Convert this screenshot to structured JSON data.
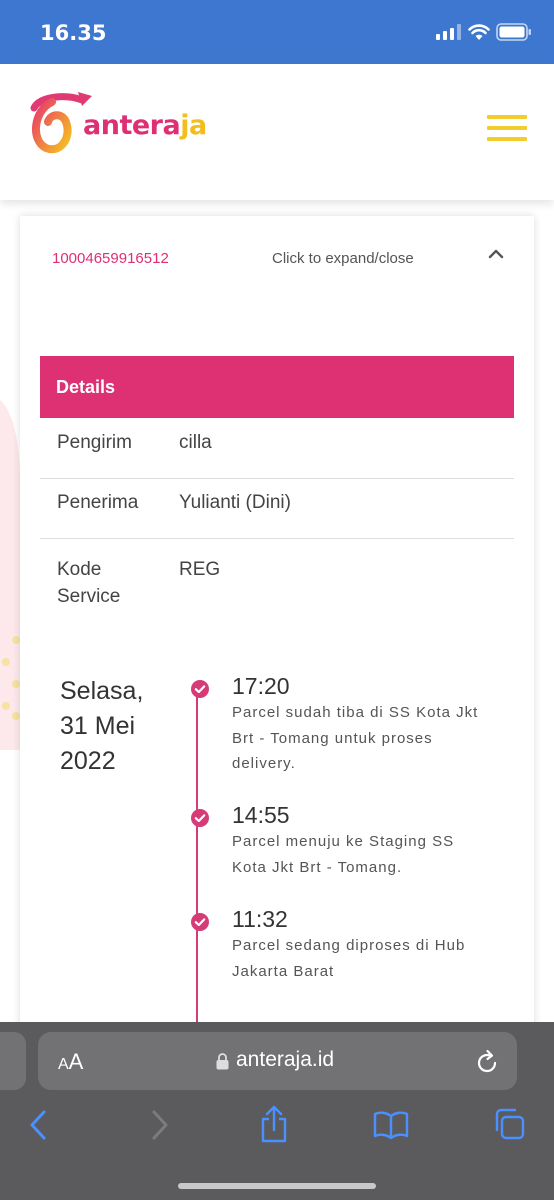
{
  "status_bar": {
    "time": "16.35"
  },
  "header": {
    "logo": {
      "part1": "antera",
      "part2": "ja"
    },
    "menu_icon": "hamburger-icon"
  },
  "tracking": {
    "awb_number": "10004659916512",
    "expand_label": "Click to expand/close",
    "details_title": "Details",
    "fields": [
      {
        "label": "Pengirim",
        "value": "cilla"
      },
      {
        "label": "Penerima",
        "value": "Yulianti (Dini)"
      },
      {
        "label": "Kode Service",
        "value": "REG"
      }
    ],
    "date_group": {
      "date_line1": "Selasa,",
      "date_line2": "31 Mei",
      "date_line3": "2022"
    },
    "events": [
      {
        "time": "17:20",
        "description": "Parcel sudah tiba di SS Kota Jkt Brt - Tomang untuk proses delivery."
      },
      {
        "time": "14:55",
        "description": "Parcel menuju ke Staging SS Kota Jkt Brt - Tomang."
      },
      {
        "time": "11:32",
        "description": "Parcel sedang diproses di Hub Jakarta Barat"
      }
    ]
  },
  "browser": {
    "aa_label": "AA",
    "url": "anteraja.id"
  },
  "colors": {
    "brand_pink": "#dd3174",
    "brand_yellow": "#f3cd2b",
    "status_bar": "#3e77cf"
  }
}
